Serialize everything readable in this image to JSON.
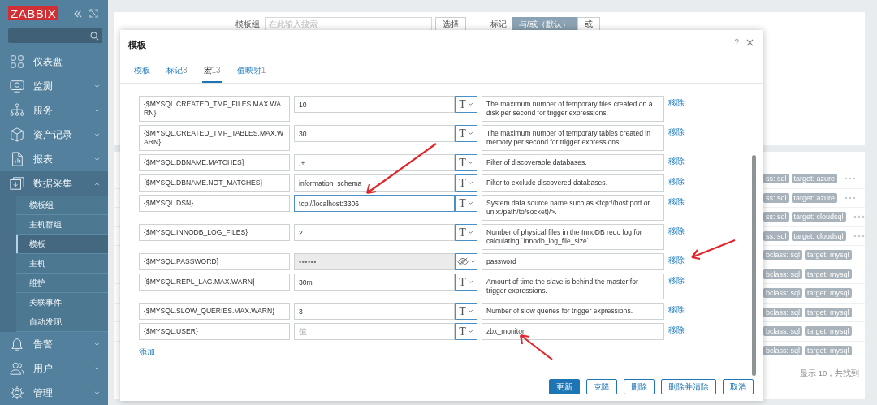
{
  "sidebar": {
    "logo": "ZABBIX",
    "menu": [
      {
        "label": "仪表盘"
      },
      {
        "label": "监测",
        "expanded": false
      },
      {
        "label": "服务",
        "expanded": false
      },
      {
        "label": "资产记录",
        "expanded": false
      },
      {
        "label": "报表",
        "expanded": false
      },
      {
        "label": "数据采集",
        "expanded": true,
        "children": [
          {
            "label": "模板组",
            "selected": false
          },
          {
            "label": "主机群组",
            "selected": false
          },
          {
            "label": "模板",
            "selected": true
          },
          {
            "label": "主机",
            "selected": false
          },
          {
            "label": "维护",
            "selected": false
          },
          {
            "label": "关联事件",
            "selected": false
          },
          {
            "label": "自动发现",
            "selected": false
          }
        ]
      },
      {
        "label": "告警",
        "expanded": false
      },
      {
        "label": "用户",
        "expanded": false
      },
      {
        "label": "管理",
        "expanded": false
      }
    ]
  },
  "background": {
    "filter": {
      "group_label": "模板组",
      "group_placeholder": "在此输入搜索",
      "select_button": "选择",
      "tags_label": "标记",
      "tag_modes": [
        {
          "label": "与/或（默认）",
          "selected": true
        },
        {
          "label": "或",
          "selected": false
        }
      ]
    },
    "rows": [
      {
        "class_tag": "ss: sql",
        "target_tag": "target: azure",
        "more": true
      },
      {
        "class_tag": "ss: sql",
        "target_tag": "target: azure",
        "more": true
      },
      {
        "class_tag": "ss: sql",
        "target_tag": "target: cloudsql",
        "more": true
      },
      {
        "class_tag": "ss: sql",
        "target_tag": "target: cloudsql",
        "more": true
      },
      {
        "class_tag": "bclass: sql",
        "target_tag": "target: mysql",
        "more": false
      },
      {
        "class_tag": "bclass: sql",
        "target_tag": "target: mysql",
        "more": false
      },
      {
        "class_tag": "bclass: sql",
        "target_tag": "target: mysql",
        "more": false
      },
      {
        "class_tag": "bclass: sql",
        "target_tag": "target: mysql",
        "more": false
      },
      {
        "class_tag": "bclass: sql",
        "target_tag": "target: mysql",
        "more": false
      },
      {
        "class_tag": "bclass: sql",
        "target_tag": "target: mysql",
        "more": false
      }
    ],
    "footer": "显示 10，共找到"
  },
  "modal": {
    "title": "模板",
    "help": "?",
    "tabs": [
      {
        "label": "模板",
        "selected": false
      },
      {
        "label": "标记",
        "count": "3",
        "selected": false
      },
      {
        "label": "宏",
        "count": "13",
        "selected": true
      },
      {
        "label": "值映射",
        "count": "1",
        "selected": false
      }
    ],
    "macros": [
      {
        "macro": "{$MYSQL.CREATED_TMP_FILES.MAX.WARN}",
        "value": "10",
        "kind": "text",
        "type_label": "T",
        "focused": false,
        "description": "The maximum number of temporary files created on a disk per second for trigger expressions.",
        "remove": "移除"
      },
      {
        "macro": "{$MYSQL.CREATED_TMP_TABLES.MAX.WARN}",
        "value": "30",
        "kind": "text",
        "type_label": "T",
        "focused": false,
        "description": "The maximum number of temporary tables created in memory per second for trigger expressions.",
        "remove": "移除"
      },
      {
        "macro": "{$MYSQL.DBNAME.MATCHES}",
        "value": ".+",
        "kind": "text",
        "type_label": "T",
        "focused": false,
        "description": "Filter of discoverable databases.",
        "remove": "移除"
      },
      {
        "macro": "{$MYSQL.DBNAME.NOT_MATCHES}",
        "value": "information_schema",
        "kind": "text",
        "type_label": "T",
        "focused": false,
        "description": "Filter to exclude discovered databases.",
        "remove": "移除"
      },
      {
        "macro": "{$MYSQL.DSN}",
        "value": "tcp://localhost:3306",
        "kind": "text",
        "type_label": "T",
        "focused": true,
        "description": "System data source name such as <tcp://host:port or unix:/path/to/socket)/>.",
        "remove": "移除"
      },
      {
        "macro": "{$MYSQL.INNODB_LOG_FILES}",
        "value": "2",
        "kind": "text",
        "type_label": "T",
        "focused": false,
        "description": "Number of physical files in the InnoDB redo log for calculating `innodb_log_file_size`.",
        "remove": "移除"
      },
      {
        "macro": "{$MYSQL.PASSWORD}",
        "value": "••••••",
        "kind": "secret",
        "focused": false,
        "description": "password",
        "remove": "移除"
      },
      {
        "macro": "{$MYSQL.REPL_LAG.MAX.WARN}",
        "value": "30m",
        "kind": "text",
        "type_label": "T",
        "focused": false,
        "description": "Amount of time the slave is behind the master for trigger expressions.",
        "remove": "移除"
      },
      {
        "macro": "{$MYSQL.SLOW_QUERIES.MAX.WARN}",
        "value": "3",
        "kind": "text",
        "type_label": "T",
        "focused": false,
        "description": "Number of slow queries for trigger expressions.",
        "remove": "移除"
      },
      {
        "macro": "{$MYSQL.USER}",
        "placeholder": "值",
        "kind": "text",
        "type_label": "T",
        "focused": false,
        "description": "zbx_monitor",
        "remove": "移除"
      }
    ],
    "add_link": "添加",
    "buttons": [
      {
        "label": "更新",
        "primary": true
      },
      {
        "label": "克隆",
        "primary": false
      },
      {
        "label": "删除",
        "primary": false
      },
      {
        "label": "删除并清除",
        "primary": false
      },
      {
        "label": "取消",
        "primary": false
      }
    ]
  }
}
